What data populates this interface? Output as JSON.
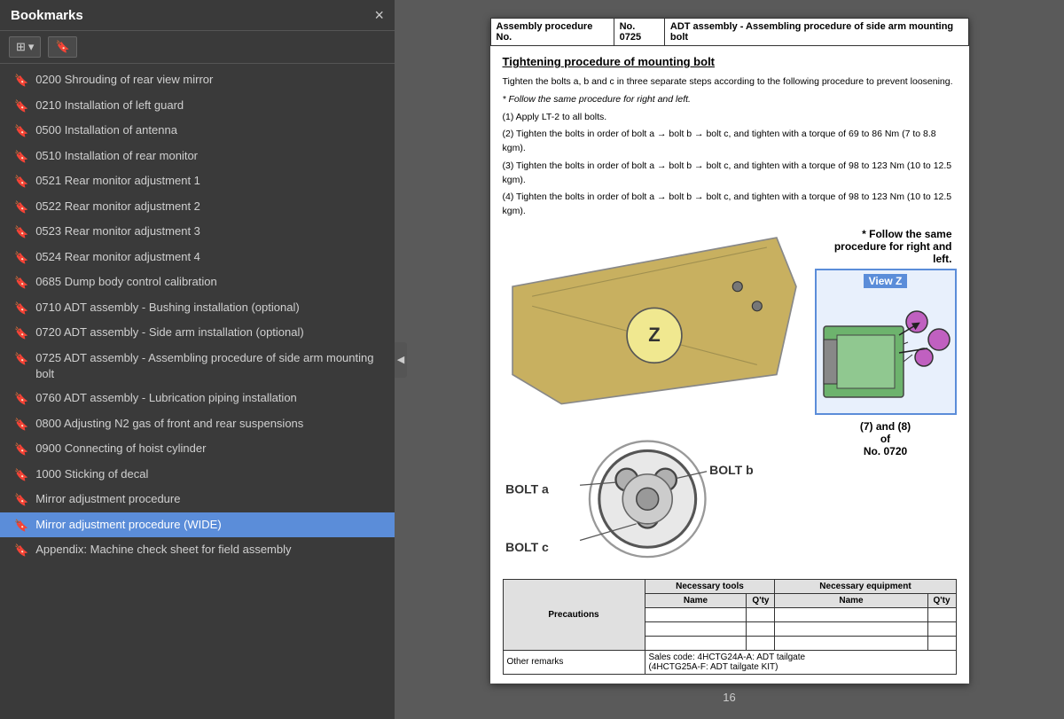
{
  "sidebar": {
    "title": "Bookmarks",
    "close_label": "×",
    "toolbar": {
      "view_btn": "☰ ▾",
      "bookmark_btn": "🔖"
    },
    "items": [
      {
        "id": "item-0200",
        "label": "0200 Shrouding of rear view mirror",
        "active": false
      },
      {
        "id": "item-0210",
        "label": "0210 Installation of left guard",
        "active": false
      },
      {
        "id": "item-0500",
        "label": "0500 Installation of antenna",
        "active": false
      },
      {
        "id": "item-0510",
        "label": "0510 Installation of rear monitor",
        "active": false
      },
      {
        "id": "item-0521",
        "label": "0521 Rear monitor adjustment 1",
        "active": false
      },
      {
        "id": "item-0522",
        "label": "0522 Rear monitor adjustment 2",
        "active": false
      },
      {
        "id": "item-0523",
        "label": "0523 Rear monitor adjustment 3",
        "active": false
      },
      {
        "id": "item-0524",
        "label": "0524 Rear monitor adjustment 4",
        "active": false
      },
      {
        "id": "item-0685",
        "label": "0685 Dump body control calibration",
        "active": false
      },
      {
        "id": "item-0710",
        "label": "0710 ADT assembly - Bushing installation (optional)",
        "active": false
      },
      {
        "id": "item-0720",
        "label": "0720 ADT assembly - Side arm installation (optional)",
        "active": false
      },
      {
        "id": "item-0725",
        "label": "0725 ADT assembly - Assembling procedure of side arm mounting bolt",
        "active": false
      },
      {
        "id": "item-0760",
        "label": "0760 ADT assembly - Lubrication piping installation",
        "active": false
      },
      {
        "id": "item-0800",
        "label": "0800 Adjusting N2 gas of front and rear suspensions",
        "active": false
      },
      {
        "id": "item-0900",
        "label": "0900 Connecting of hoist cylinder",
        "active": false
      },
      {
        "id": "item-1000",
        "label": "1000 Sticking of decal",
        "active": false
      },
      {
        "id": "item-mirror",
        "label": "Mirror adjustment procedure",
        "active": false
      },
      {
        "id": "item-mirror-wide",
        "label": "Mirror adjustment procedure (WIDE)",
        "active": true
      },
      {
        "id": "item-appendix",
        "label": "Appendix: Machine check sheet for field assembly",
        "active": false
      }
    ]
  },
  "pdf": {
    "header": {
      "col1": "Assembly procedure No.",
      "col2": "No. 0725",
      "col3": "ADT assembly - Assembling procedure of side arm mounting bolt"
    },
    "section_title": "Tightening procedure of mounting bolt",
    "intro": "Tighten the bolts a, b and c in three separate steps according to the following procedure to prevent loosening.",
    "note1": "* Follow the same procedure for right and left.",
    "steps": [
      "(1) Apply LT-2 to all bolts.",
      "(2) Tighten the bolts in order of bolt a → bolt b → bolt c, and tighten with a torque of 69 to 86 Nm (7 to 8.8 kgm).",
      "(3) Tighten the bolts in order of bolt a → bolt b → bolt c, and tighten with a torque of 98 to 123 Nm (10 to 12.5 kgm).",
      "(4) Tighten the bolts in order of bolt a → bolt b → bolt c, and tighten with a torque of 98 to 123 Nm (10 to 12.5 kgm)."
    ],
    "follow_note": "* Follow the same\nprocedure for right and left.",
    "view_z_label": "View Z",
    "ref_note": "(7) and (8)\nof\nNo. 0720",
    "bolt_labels": [
      "BOLT a",
      "BOLT b",
      "BOLT c"
    ],
    "footer": {
      "precautions_label": "Precautions",
      "tools_label": "Necessary tools",
      "equipment_label": "Necessary equipment",
      "name_label": "Name",
      "qty_label": "Q'ty",
      "other_remarks_label": "Other remarks",
      "sales_code": "Sales code: 4HCTG24A-A: ADT tailgate\n(4HCTG25A-F: ADT tailgate KIT)"
    }
  },
  "page_number": "16",
  "icons": {
    "bookmark": "🔖",
    "collapse": "◀"
  }
}
